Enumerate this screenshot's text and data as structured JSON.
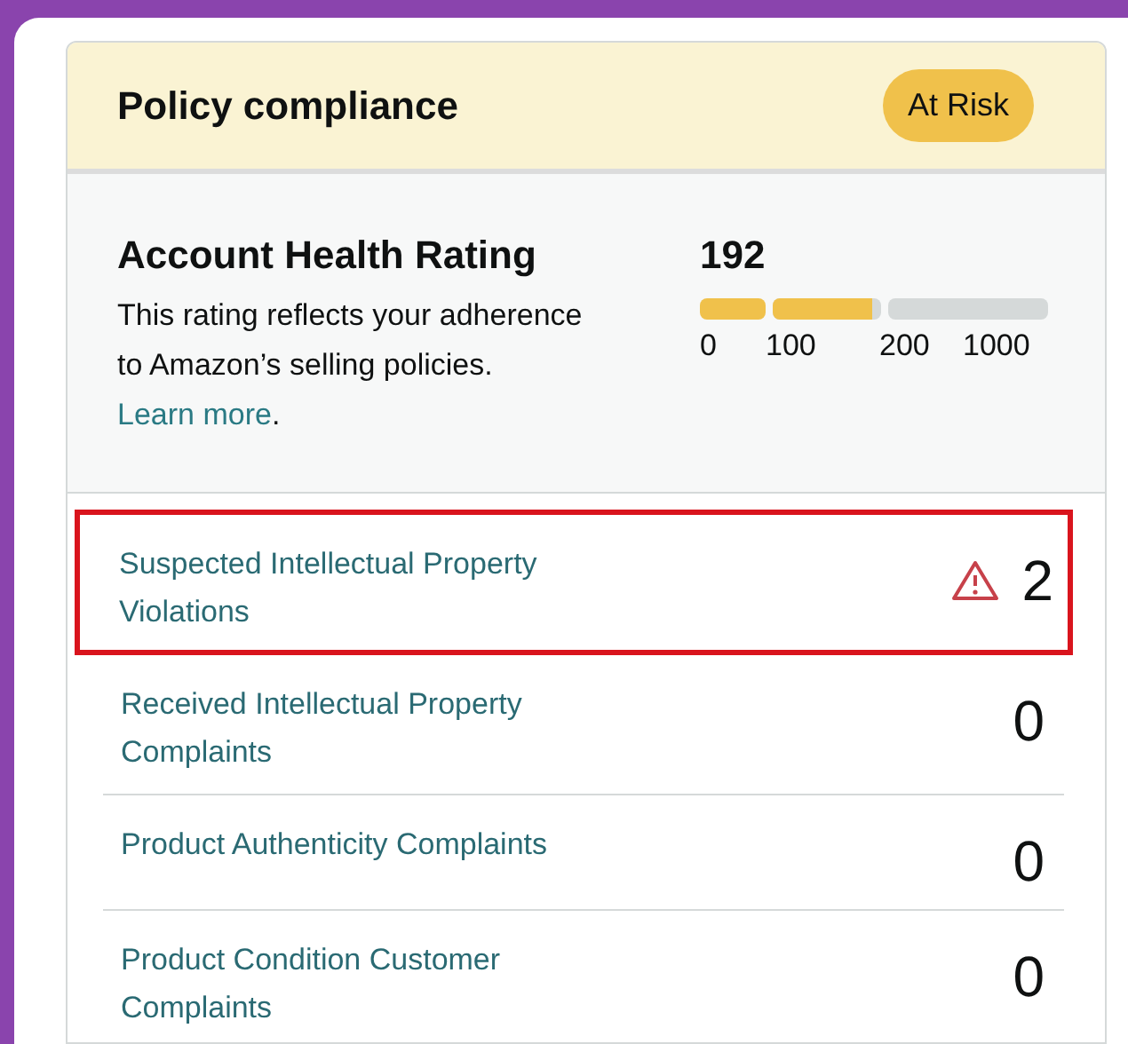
{
  "header": {
    "title": "Policy compliance",
    "status": "At Risk"
  },
  "rating": {
    "title": "Account Health Rating",
    "description": "This rating reflects your adherence to Amazon’s selling policies.",
    "link": "Learn more",
    "link_suffix": ".",
    "value": "192",
    "segments": [
      {
        "level": 1
      },
      {
        "level": 0.92
      },
      {
        "level": 0
      }
    ],
    "ticks": [
      "0",
      "100",
      "200",
      "1000"
    ]
  },
  "rows": [
    {
      "label": "Suspected Intellectual Property Violations",
      "count": "2",
      "highlighted": true,
      "warning": true
    },
    {
      "label": "Received Intellectual Property Complaints",
      "count": "0",
      "highlighted": false,
      "warning": false
    },
    {
      "label": "Product Authenticity Complaints",
      "count": "0",
      "highlighted": false,
      "warning": false
    },
    {
      "label": "Product Condition Customer Complaints",
      "count": "0",
      "highlighted": false,
      "warning": false
    }
  ]
}
